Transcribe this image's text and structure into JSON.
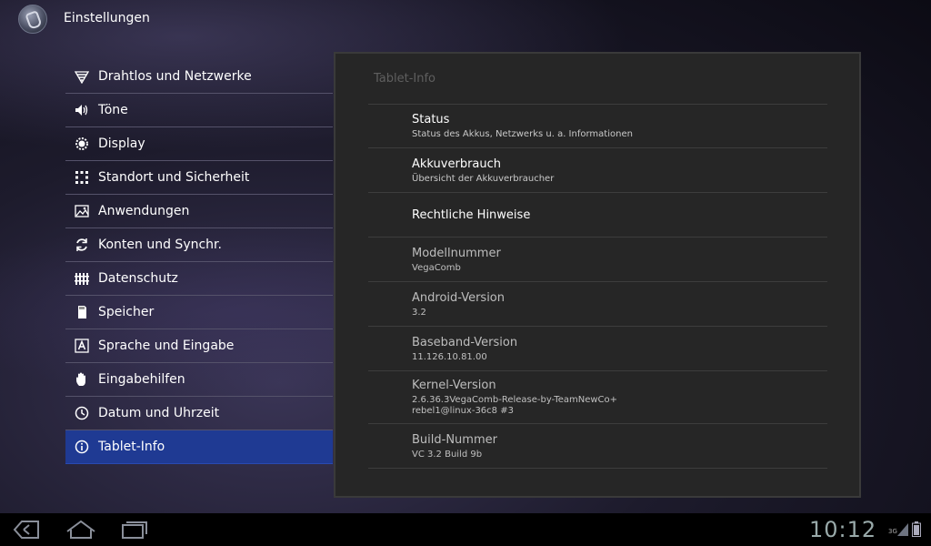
{
  "app": {
    "title": "Einstellungen"
  },
  "menu": {
    "items": [
      {
        "label": "Drahtlos und Netzwerke",
        "icon": "wifi-icon",
        "active": false
      },
      {
        "label": "Töne",
        "icon": "speaker-icon",
        "active": false
      },
      {
        "label": "Display",
        "icon": "brightness-icon",
        "active": false
      },
      {
        "label": "Standort und Sicherheit",
        "icon": "location-grid-icon",
        "active": false
      },
      {
        "label": "Anwendungen",
        "icon": "apps-icon",
        "active": false
      },
      {
        "label": "Konten und Synchr.",
        "icon": "sync-icon",
        "active": false
      },
      {
        "label": "Datenschutz",
        "icon": "privacy-icon",
        "active": false
      },
      {
        "label": "Speicher",
        "icon": "sdcard-icon",
        "active": false
      },
      {
        "label": "Sprache und Eingabe",
        "icon": "keyboard-a-icon",
        "active": false
      },
      {
        "label": "Eingabehilfen",
        "icon": "hand-icon",
        "active": false
      },
      {
        "label": "Datum und Uhrzeit",
        "icon": "clock-icon",
        "active": false
      },
      {
        "label": "Tablet-Info",
        "icon": "info-icon",
        "active": true
      }
    ]
  },
  "panel": {
    "header": "Tablet-Info",
    "rows": [
      {
        "title": "Status",
        "subtitle": "Status des Akkus, Netzwerks u. a. Informationen",
        "clickable": true
      },
      {
        "title": "Akkuverbrauch",
        "subtitle": "Übersicht der Akkuverbraucher",
        "clickable": true
      },
      {
        "title": "Rechtliche Hinweise",
        "subtitle": "",
        "clickable": true
      },
      {
        "title": "Modellnummer",
        "subtitle": "VegaComb",
        "clickable": false
      },
      {
        "title": "Android-Version",
        "subtitle": "3.2",
        "clickable": false
      },
      {
        "title": "Baseband-Version",
        "subtitle": "11.126.10.81.00",
        "clickable": false
      },
      {
        "title": "Kernel-Version",
        "subtitle": "2.6.36.3VegaComb-Release-by-TeamNewCo+",
        "subtitle2": "rebel1@linux-36c8 #3",
        "clickable": false
      },
      {
        "title": "Build-Nummer",
        "subtitle": "VC 3.2 Build 9b",
        "clickable": false
      }
    ]
  },
  "systembar": {
    "time": "10:12",
    "network": "3G",
    "buttons": {
      "back": "back-icon",
      "home": "home-icon",
      "recents": "recent-apps-icon"
    }
  }
}
